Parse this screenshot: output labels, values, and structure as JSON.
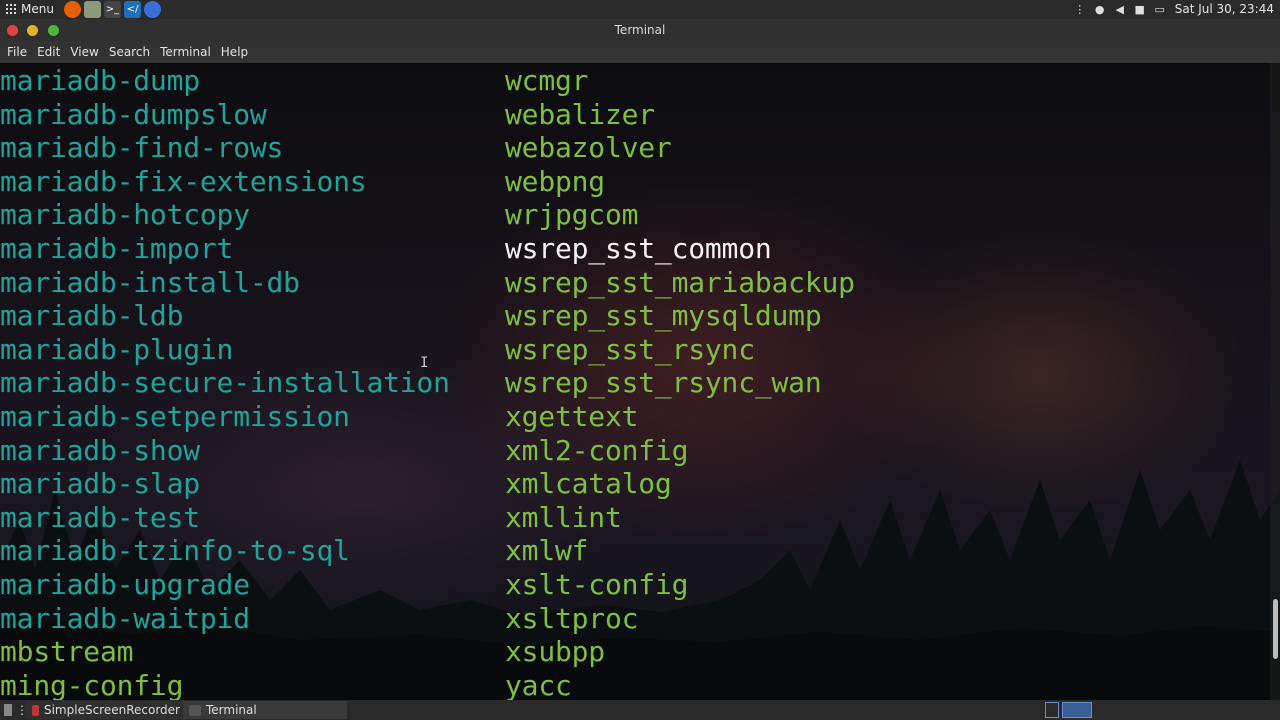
{
  "top_panel": {
    "menu_label": "Menu",
    "clock": "Sat Jul 30, 23:44"
  },
  "window": {
    "title": "Terminal"
  },
  "menubar": {
    "items": [
      "File",
      "Edit",
      "View",
      "Search",
      "Terminal",
      "Help"
    ]
  },
  "terminal": {
    "left_column": [
      "mariadb-dump",
      "mariadb-dumpslow",
      "mariadb-find-rows",
      "mariadb-fix-extensions",
      "mariadb-hotcopy",
      "mariadb-import",
      "mariadb-install-db",
      "mariadb-ldb",
      "mariadb-plugin",
      "mariadb-secure-installation",
      "mariadb-setpermission",
      "mariadb-show",
      "mariadb-slap",
      "mariadb-test",
      "mariadb-tzinfo-to-sql",
      "mariadb-upgrade",
      "mariadb-waitpid",
      "mbstream",
      "ming-config"
    ],
    "right_column": [
      "wcmgr",
      "webalizer",
      "webazolver",
      "webpng",
      "wrjpgcom",
      "wsrep_sst_common",
      "wsrep_sst_mariabackup",
      "wsrep_sst_mysqldump",
      "wsrep_sst_rsync",
      "wsrep_sst_rsync_wan",
      "xgettext",
      "xml2-config",
      "xmlcatalog",
      "xmllint",
      "xmlwf",
      "xslt-config",
      "xsltproc",
      "xsubpp",
      "yacc"
    ],
    "colors": {
      "link": "#1fa39a",
      "exec": "#7fbf3f",
      "plain": "#f2f2f2"
    }
  },
  "taskbar": {
    "items": [
      "SimpleScreenRecorder",
      "Terminal"
    ]
  }
}
